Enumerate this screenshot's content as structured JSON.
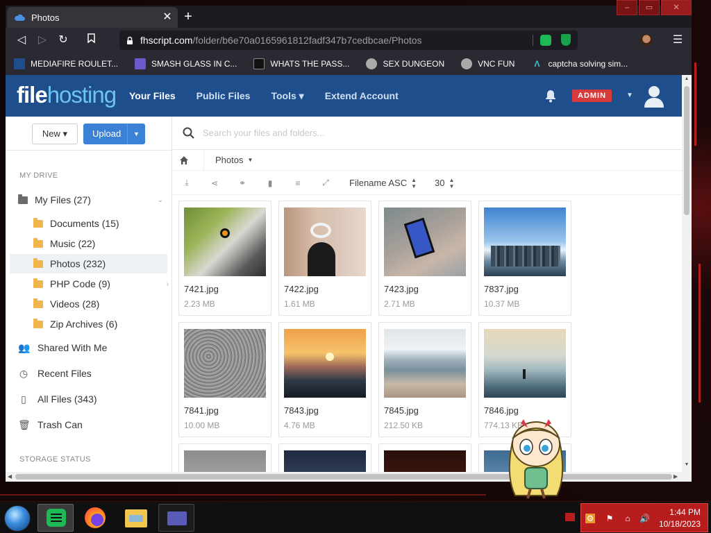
{
  "browser": {
    "tab_title": "Photos",
    "new_tab_symbol": "+",
    "url_host": "fhscript.com",
    "url_path": "/folder/b6e70a0165961812fadf347b7cedbcae/Photos",
    "bookmarks": [
      {
        "label": "MEDIAFIRE ROULET...",
        "icon": "mediafire-icon",
        "color": "#1f4e8c"
      },
      {
        "label": "SMASH GLASS IN C...",
        "icon": "sigma-icon",
        "color": "#6a5acd"
      },
      {
        "label": "WHATS THE PASS...",
        "icon": "lock-icon",
        "color": "#111111"
      },
      {
        "label": "SEX DUNGEON",
        "icon": "bookmark-icon",
        "color": "#aaaaaa"
      },
      {
        "label": "VNC FUN",
        "icon": "bookmark-icon",
        "color": "#aaaaaa"
      },
      {
        "label": "captcha solving sim...",
        "icon": "lambda-icon",
        "color": "#3fc1c9"
      }
    ]
  },
  "app": {
    "logo_a": "file",
    "logo_b": "hosting",
    "nav": [
      {
        "label": "Your Files",
        "active": true
      },
      {
        "label": "Public Files",
        "active": false
      },
      {
        "label": "Tools ▾",
        "active": false
      },
      {
        "label": "Extend Account",
        "active": false
      }
    ],
    "admin_badge": "ADMIN",
    "brand_color": "#1f4e8c"
  },
  "sidebar": {
    "new_label": "New ▾",
    "upload_label": "Upload",
    "my_drive_heading": "MY DRIVE",
    "storage_heading": "STORAGE STATUS",
    "items": [
      {
        "label": "My Files (27)"
      },
      {
        "label": "Documents (15)"
      },
      {
        "label": "Music (22)"
      },
      {
        "label": "Photos (232)"
      },
      {
        "label": "PHP Code (9)"
      },
      {
        "label": "Videos (28)"
      },
      {
        "label": "Zip Archives (6)"
      },
      {
        "label": "Shared With Me"
      },
      {
        "label": "Recent Files"
      },
      {
        "label": "All Files (343)"
      },
      {
        "label": "Trash Can"
      }
    ]
  },
  "main": {
    "search_placeholder": "Search your files and folders...",
    "breadcrumb": "Photos",
    "sort_label": "Filename ASC",
    "per_page": "30",
    "files": [
      {
        "name": "7421.jpg",
        "size": "2.23 MB"
      },
      {
        "name": "7422.jpg",
        "size": "1.61 MB"
      },
      {
        "name": "7423.jpg",
        "size": "2.71 MB"
      },
      {
        "name": "7837.jpg",
        "size": "10.37 MB"
      },
      {
        "name": "7841.jpg",
        "size": "10.00 MB"
      },
      {
        "name": "7843.jpg",
        "size": "4.76 MB"
      },
      {
        "name": "7845.jpg",
        "size": "212.50 KB"
      },
      {
        "name": "7846.jpg",
        "size": "774.13 KB"
      }
    ]
  },
  "taskbar": {
    "time": "1:44 PM",
    "date": "10/18/2023"
  }
}
